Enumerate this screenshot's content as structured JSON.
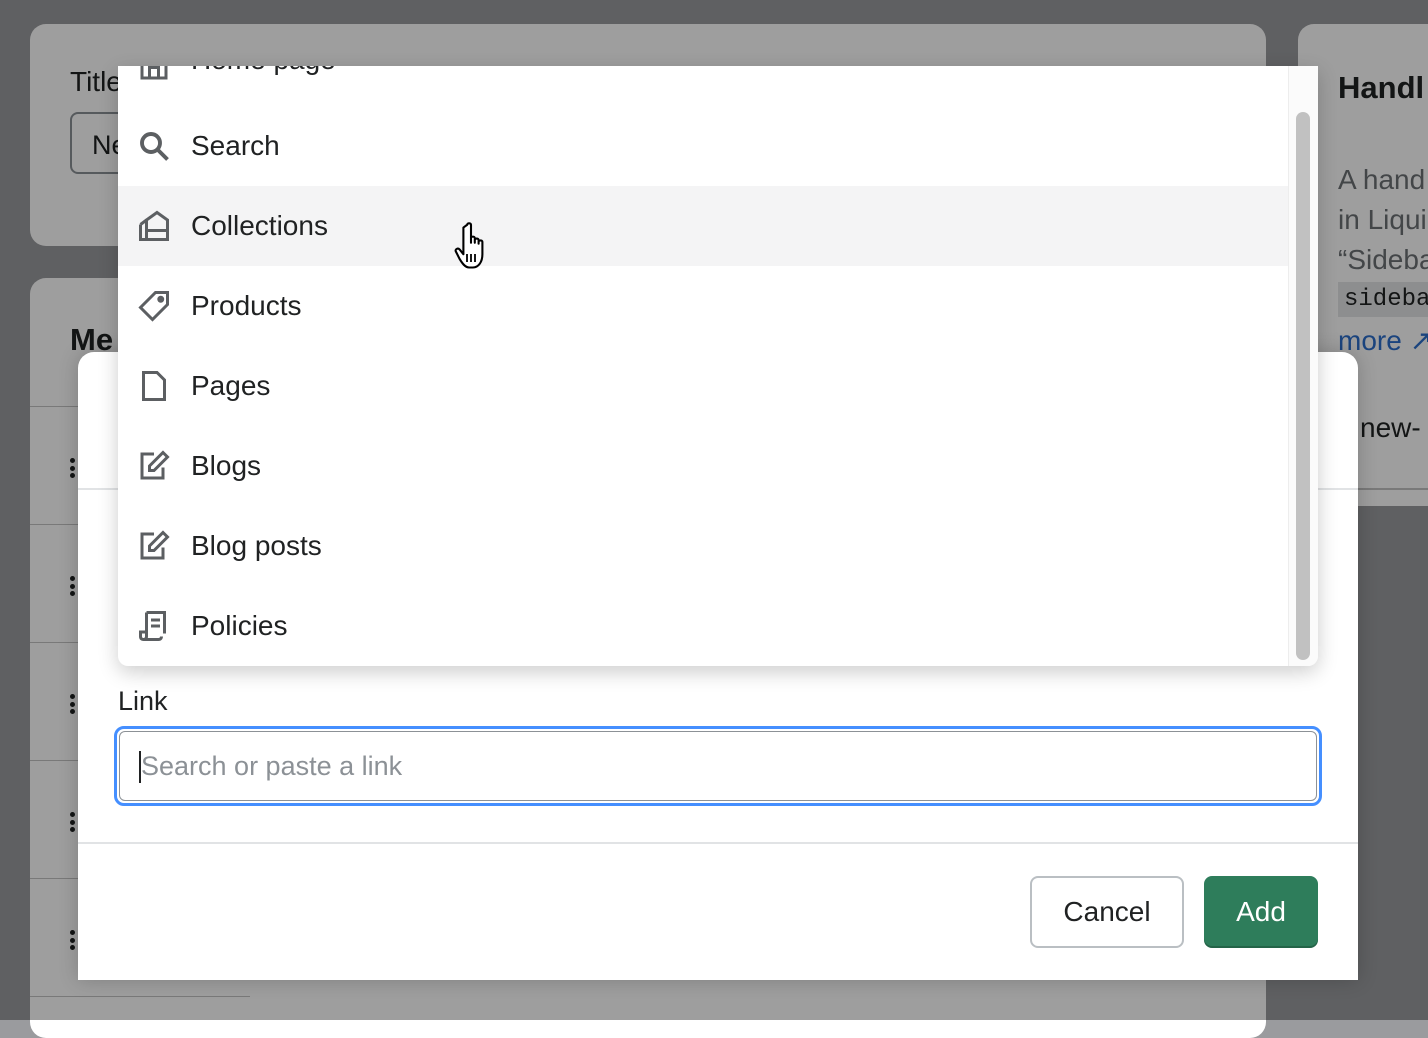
{
  "background": {
    "title_label": "Title",
    "title_value": "Ne",
    "menu_heading": "Me",
    "handle_title": "Handl",
    "handle_desc_lines": [
      "A hand",
      "in Liqui",
      "“Sideba"
    ],
    "handle_code": "sideba",
    "handle_more_link": "more",
    "handle_value": "new-"
  },
  "dropdown": {
    "items": [
      {
        "label": "Home page",
        "icon": "home-icon"
      },
      {
        "label": "Search",
        "icon": "search-icon"
      },
      {
        "label": "Collections",
        "icon": "collections-icon"
      },
      {
        "label": "Products",
        "icon": "tag-icon"
      },
      {
        "label": "Pages",
        "icon": "page-icon"
      },
      {
        "label": "Blogs",
        "icon": "blog-edit-icon"
      },
      {
        "label": "Blog posts",
        "icon": "blog-post-edit-icon"
      },
      {
        "label": "Policies",
        "icon": "policy-scroll-icon"
      }
    ],
    "hovered_label": "Collections"
  },
  "modal": {
    "link_label": "Link",
    "link_input": {
      "value": "",
      "placeholder": "Search or paste a link"
    },
    "cancel_label": "Cancel",
    "add_label": "Add"
  },
  "colors": {
    "primary_button": "#2e7d5b",
    "focus_ring": "#458fff",
    "link": "#2c6ecb"
  }
}
